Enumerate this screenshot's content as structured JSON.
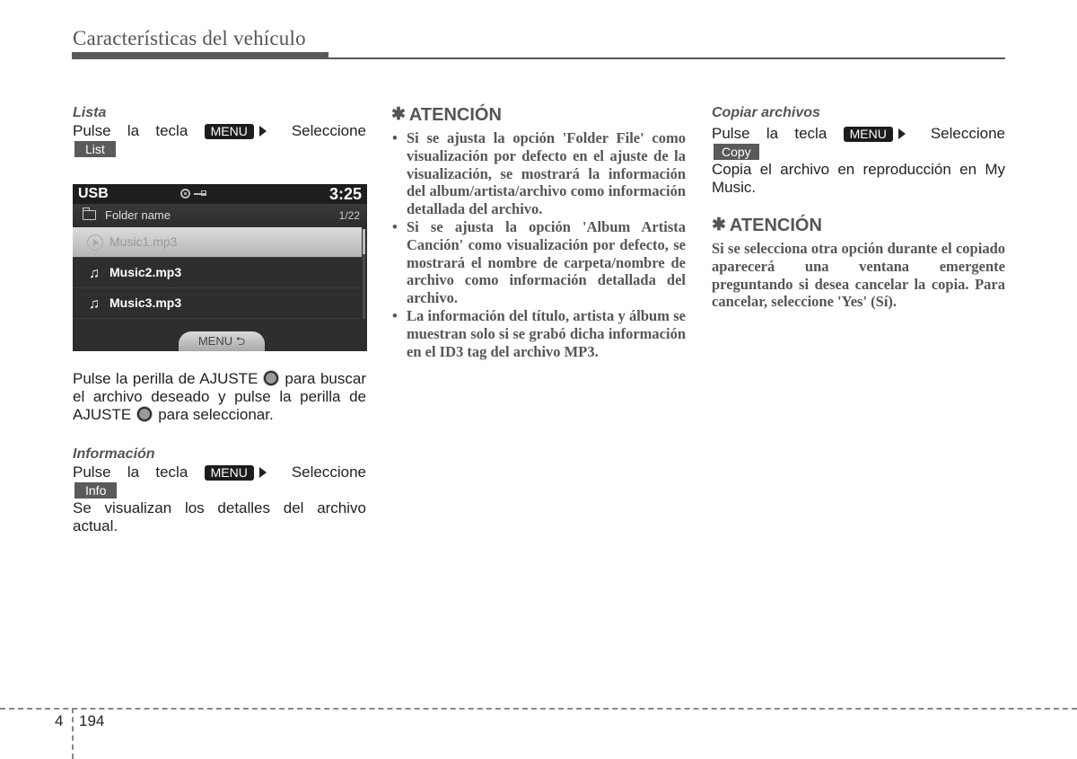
{
  "header": {
    "title": "Características del vehículo"
  },
  "left": {
    "lista": {
      "heading": "Lista",
      "press": {
        "w1": "Pulse",
        "w2": "la",
        "w3": "tecla",
        "key": "MENU",
        "select": "Seleccione"
      },
      "option": "List"
    },
    "screen": {
      "source": "USB",
      "clock": "3:25",
      "folder": "Folder name",
      "count": "1/22",
      "tracks": [
        {
          "name": "Music1.mp3",
          "state": "selected-playing"
        },
        {
          "name": "Music2.mp3",
          "state": "normal"
        },
        {
          "name": "Music3.mp3",
          "state": "normal"
        }
      ],
      "menu_tab": "MENU ⮌"
    },
    "knob_text": {
      "part1": "Pulse la perilla de AJUSTE",
      "part2": "para buscar el archivo deseado y pulse la perilla de AJUSTE",
      "part3": "para seleccionar."
    },
    "info": {
      "heading": "Información",
      "press": {
        "w1": "Pulse",
        "w2": "la",
        "w3": "tecla",
        "key": "MENU",
        "select": "Seleccione"
      },
      "option": "Info",
      "description": "Se visualizan los detalles del archivo actual."
    }
  },
  "middle": {
    "attention_title": "ATENCIÓN",
    "bullets": [
      "Si se ajusta la opción 'Folder File' como visualización por defecto en el ajuste de la visualización, se mostrará la información del album/artista/archivo como información detallada del archivo.",
      "Si se ajusta la opción 'Album Artista Canción' como visualización por defecto, se mostrará el nombre de carpeta/nombre de archivo como información detallada del archivo.",
      "La información del título, artista y álbum se muestran solo si se grabó dicha información en el ID3 tag del archivo MP3."
    ]
  },
  "right": {
    "copy": {
      "heading": "Copiar archivos",
      "press": {
        "w1": "Pulse",
        "w2": "la",
        "w3": "tecla",
        "key": "MENU",
        "select": "Seleccione"
      },
      "option": "Copy",
      "description": "Copia el archivo en reproducción en My Music."
    },
    "attention_title": "ATENCIÓN",
    "attention_text": "Si se selecciona otra opción durante el copiado aparecerá una ventana emergente preguntando si desea cancelar la copia. Para cancelar, seleccione 'Yes' (Sí)."
  },
  "footer": {
    "chapter": "4",
    "page": "194"
  }
}
